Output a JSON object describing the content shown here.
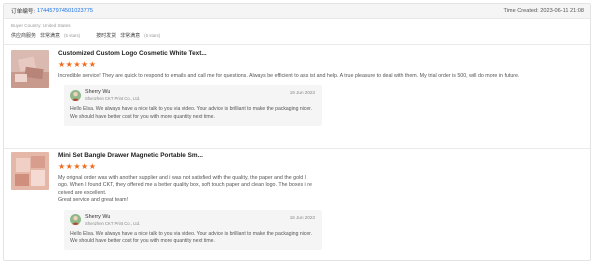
{
  "header": {
    "order_label": "订单编号:",
    "order_number": "174457974501023775",
    "time_created": "Time Created: 2023-06-11 21:08"
  },
  "meta": {
    "country": "Buyer Country: United States",
    "ratings": [
      {
        "label": "供应商服务",
        "value": "非常满意",
        "stars": "(5 stars)"
      },
      {
        "label": "按时发货",
        "value": "非常满意",
        "stars": "(5 stars)"
      }
    ]
  },
  "reviews": [
    {
      "product_title": "Customized Custom Logo Cosmetic White Text...",
      "rating": 5,
      "text": "Incredible service! They are quick to respond to emails and call me for questions. Always be efficient to ass ist and help. A true pleasure to deal with them. My trial order is 500, will do more in future.",
      "reply": {
        "name": "Sherry Wu",
        "company": "Shenzhen CKT Print Co., Ltd.",
        "date": "19 Jun 2023",
        "text": "Hello Elsa. We always have a nice talk to you via video. Your advice is brilliant to make the packaging nicer. We should have better cost for you with more quantity next time."
      }
    },
    {
      "product_title": "Mini Set Bangle Drawer Magnetic Portable Sm...",
      "rating": 5,
      "text_lines": [
        "My orignal order was with another supplier and i was not satisfied with the quality, the paper and the gold l",
        "ogo. When I found CKT, they offered me a better quality box, soft touch paper and clean logo. The boxes i re",
        "ceived are excellent.",
        "Great service and great team!"
      ],
      "reply": {
        "name": "Sherry Wu",
        "company": "Shenzhen CKT Print Co., Ltd.",
        "date": "16 Jun 2023",
        "text": "Hello Elsa. We always have a nice talk to you via video. Your advice is brilliant to make the packaging nicer. We should have better cost for you with more quantity next time."
      }
    }
  ],
  "colors": {
    "star": "#f06a1c",
    "link": "#1a73e8"
  }
}
